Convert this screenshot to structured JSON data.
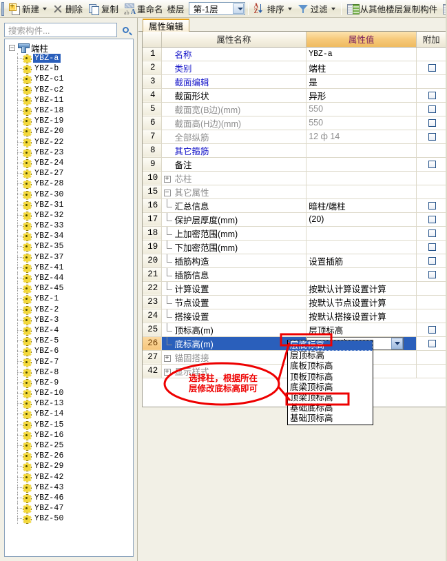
{
  "toolbar": {
    "items": [
      {
        "label": "新建",
        "icon": "new-icon",
        "caret": true
      },
      {
        "label": "删除",
        "icon": "delete-x-icon",
        "caret": false
      },
      {
        "label": "复制",
        "icon": "copy-icon",
        "caret": false
      },
      {
        "label": "重命名",
        "icon": "rename-icon",
        "caret": false
      }
    ],
    "floor_label": "楼层",
    "floor_value": "第-1层",
    "sort_label": "排序",
    "filter_label": "过滤",
    "copy_from_floor_label": "从其他楼层复制构件",
    "copy_trailing_label": "复制"
  },
  "search": {
    "placeholder": "搜索构件...",
    "value": "",
    "icon": "search-icon"
  },
  "tree": {
    "root_label": "端柱",
    "root_expanded": true,
    "selected": "YBZ-a",
    "items": [
      "YBZ-a",
      "YBZ-b",
      "YBZ-c1",
      "YBZ-c2",
      "YBZ-11",
      "YBZ-18",
      "YBZ-19",
      "YBZ-20",
      "YBZ-22",
      "YBZ-23",
      "YBZ-24",
      "YBZ-27",
      "YBZ-28",
      "YBZ-30",
      "YBZ-31",
      "YBZ-32",
      "YBZ-33",
      "YBZ-34",
      "YBZ-35",
      "YBZ-37",
      "YBZ-41",
      "YBZ-44",
      "YBZ-45",
      "YBZ-1",
      "YBZ-2",
      "YBZ-3",
      "YBZ-4",
      "YBZ-5",
      "YBZ-6",
      "YBZ-7",
      "YBZ-8",
      "YBZ-9",
      "YBZ-10",
      "YBZ-13",
      "YBZ-14",
      "YBZ-15",
      "YBZ-16",
      "YBZ-25",
      "YBZ-26",
      "YBZ-29",
      "YBZ-42",
      "YBZ-43",
      "YBZ-46",
      "YBZ-47",
      "YBZ-50"
    ]
  },
  "tabs": [
    {
      "label": "属性编辑",
      "active": true
    }
  ],
  "grid": {
    "headers": {
      "num": "",
      "name": "属性名称",
      "value": "属性值",
      "attach": "附加"
    },
    "rows": [
      {
        "num": "1",
        "name": "名称",
        "value": "YBZ-a",
        "style": "blue",
        "value_style": "mono",
        "indent": 0,
        "toggle": null,
        "checkbox": false,
        "selected": false
      },
      {
        "num": "2",
        "name": "类别",
        "value": "端柱",
        "style": "blue",
        "indent": 0,
        "toggle": null,
        "checkbox": true,
        "selected": false
      },
      {
        "num": "3",
        "name": "截面编辑",
        "value": "是",
        "style": "blue",
        "indent": 0,
        "toggle": null,
        "checkbox": false,
        "selected": false
      },
      {
        "num": "4",
        "name": "截面形状",
        "value": "异形",
        "style": "normal",
        "indent": 0,
        "toggle": null,
        "checkbox": true,
        "selected": false
      },
      {
        "num": "5",
        "name": "截面宽(B边)(mm)",
        "value": "550",
        "style": "grey",
        "value_style": "grey",
        "indent": 0,
        "toggle": null,
        "checkbox": true,
        "selected": false
      },
      {
        "num": "6",
        "name": "截面高(H边)(mm)",
        "value": "550",
        "style": "grey",
        "value_style": "grey",
        "indent": 0,
        "toggle": null,
        "checkbox": true,
        "selected": false
      },
      {
        "num": "7",
        "name": "全部纵筋",
        "value": "12 ф 14",
        "style": "grey",
        "value_style": "grey",
        "indent": 0,
        "toggle": null,
        "checkbox": true,
        "selected": false
      },
      {
        "num": "8",
        "name": "其它箍筋",
        "value": "",
        "style": "blue",
        "indent": 0,
        "toggle": null,
        "checkbox": false,
        "selected": false
      },
      {
        "num": "9",
        "name": "备注",
        "value": "",
        "style": "normal",
        "indent": 0,
        "toggle": null,
        "checkbox": true,
        "selected": false
      },
      {
        "num": "10",
        "name": "芯柱",
        "value": "",
        "style": "grey",
        "indent": 0,
        "toggle": "+",
        "checkbox": false,
        "selected": false
      },
      {
        "num": "15",
        "name": "其它属性",
        "value": "",
        "style": "grey",
        "indent": 0,
        "toggle": "-",
        "checkbox": false,
        "selected": false
      },
      {
        "num": "16",
        "name": "汇总信息",
        "value": "暗柱/端柱",
        "style": "normal",
        "indent": 1,
        "toggle": null,
        "checkbox": true,
        "selected": false
      },
      {
        "num": "17",
        "name": "保护层厚度(mm)",
        "value": "(20)",
        "style": "normal",
        "indent": 1,
        "toggle": null,
        "checkbox": true,
        "selected": false
      },
      {
        "num": "18",
        "name": "上加密范围(mm)",
        "value": "",
        "style": "normal",
        "indent": 1,
        "toggle": null,
        "checkbox": true,
        "selected": false
      },
      {
        "num": "19",
        "name": "下加密范围(mm)",
        "value": "",
        "style": "normal",
        "indent": 1,
        "toggle": null,
        "checkbox": true,
        "selected": false
      },
      {
        "num": "20",
        "name": "插筋构造",
        "value": "设置插筋",
        "style": "normal",
        "indent": 1,
        "toggle": null,
        "checkbox": true,
        "selected": false
      },
      {
        "num": "21",
        "name": "插筋信息",
        "value": "",
        "style": "normal",
        "indent": 1,
        "toggle": null,
        "checkbox": true,
        "selected": false
      },
      {
        "num": "22",
        "name": "计算设置",
        "value": "按默认计算设置计算",
        "style": "normal",
        "indent": 1,
        "toggle": null,
        "checkbox": false,
        "selected": false
      },
      {
        "num": "23",
        "name": "节点设置",
        "value": "按默认节点设置计算",
        "style": "normal",
        "indent": 1,
        "toggle": null,
        "checkbox": false,
        "selected": false
      },
      {
        "num": "24",
        "name": "搭接设置",
        "value": "按默认搭接设置计算",
        "style": "normal",
        "indent": 1,
        "toggle": null,
        "checkbox": false,
        "selected": false
      },
      {
        "num": "25",
        "name": "顶标高(m)",
        "value": "层顶标高",
        "style": "normal",
        "indent": 1,
        "toggle": null,
        "checkbox": true,
        "selected": false
      },
      {
        "num": "26",
        "name": "底标高(m)",
        "value": "层底标高",
        "style": "normal",
        "indent": 1,
        "toggle": null,
        "checkbox": true,
        "selected": true
      },
      {
        "num": "27",
        "name": "锚固搭接",
        "value": "",
        "style": "grey",
        "indent": 0,
        "toggle": "+",
        "checkbox": false,
        "selected": false
      },
      {
        "num": "42",
        "name": "显示样式",
        "value": "",
        "style": "grey",
        "indent": 0,
        "toggle": "+",
        "checkbox": false,
        "selected": false
      }
    ]
  },
  "editor": {
    "value": "层底标高",
    "dropdown_icon": "chevron-down-icon",
    "open": true
  },
  "dropdown": {
    "selected": "层底标高",
    "highlighted_outline": "基础底标高",
    "options": [
      "层底标高",
      "层顶标高",
      "底板顶标高",
      "顶板顶标高",
      "底梁顶标高",
      "顶梁顶标高",
      "基础底标高",
      "基础顶标高"
    ]
  },
  "annotation": {
    "line1": "选择柱，根据所在",
    "line2": "层修改底标高即可",
    "color": "#ee0000"
  },
  "colors": {
    "accent_orange": "#f3c878",
    "selection_blue": "#2a5fbb",
    "annotation_red": "#ee0000",
    "header_value_text": "#7a2060",
    "link_blue": "#1414c8"
  }
}
